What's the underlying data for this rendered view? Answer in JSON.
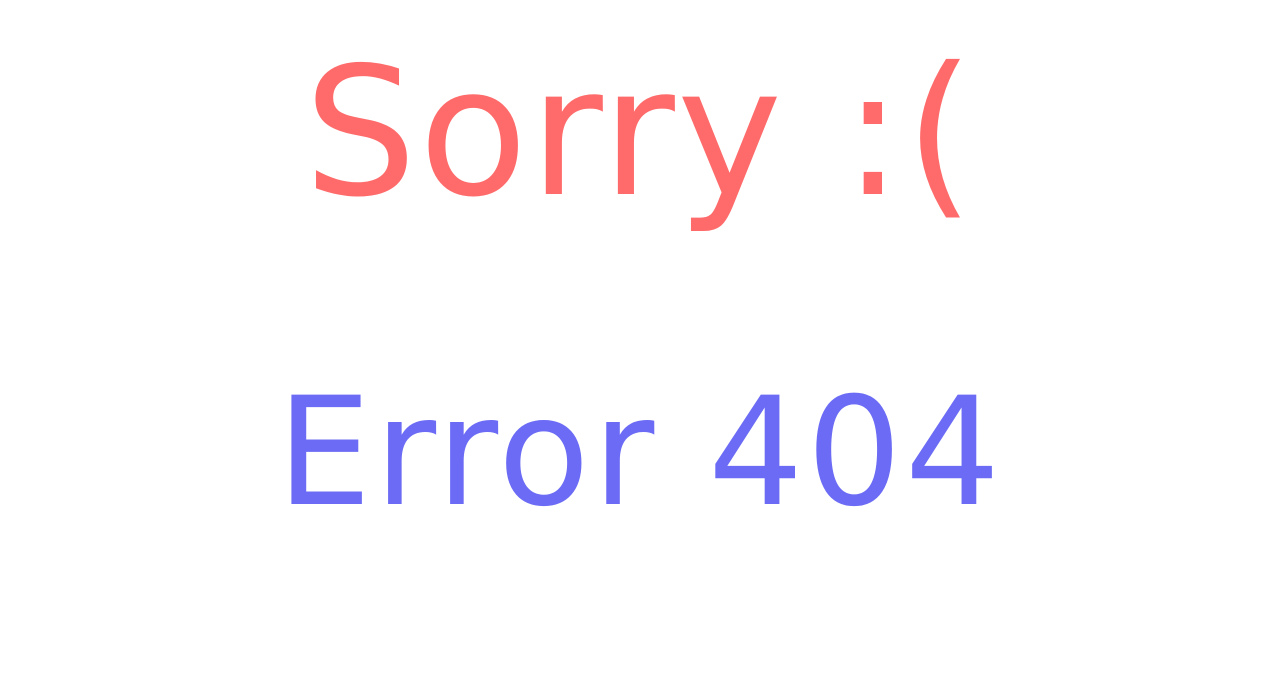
{
  "message": {
    "title": "Sorry :(",
    "subtitle": "Error 404"
  },
  "colors": {
    "background": "#ffffff",
    "title": "#ff6b6b",
    "subtitle": "#6b6bf5"
  }
}
